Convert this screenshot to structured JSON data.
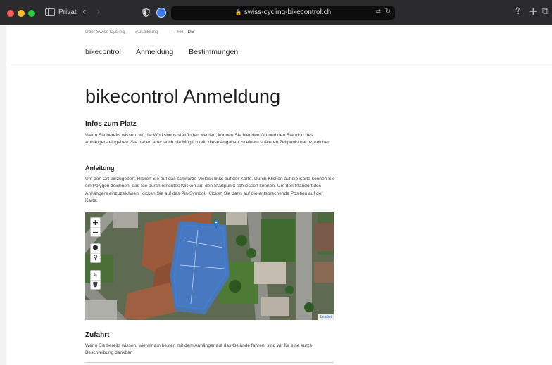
{
  "browser": {
    "tab_label": "Privat",
    "url": "swiss-cycling-bikecontrol.ch",
    "icons": [
      "sidebar-icon",
      "back-icon",
      "forward-icon",
      "shield-icon",
      "privacy-icon",
      "lock-icon",
      "translate-icon",
      "reload-icon",
      "share-icon",
      "new-tab-icon",
      "tabs-overview-icon"
    ]
  },
  "utility_nav": {
    "items": [
      "Über Swiss Cycling",
      "Ausbildung"
    ],
    "languages": [
      "IT",
      "FR",
      "DE"
    ],
    "active_language": "DE"
  },
  "main_nav": {
    "items": [
      "bikecontrol",
      "Anmeldung",
      "Bestimmungen"
    ]
  },
  "page": {
    "title": "bikecontrol Anmeldung",
    "section_place": {
      "heading": "Infos zum Platz",
      "text": "Wenn Sie bereits wissen, wo die Workshops stattfinden werden, können Sie hier den Ort und den Standort des Anhängers eingeben. Sie haben aber auch die Möglichkeit, diese Angaben zu einem späteren Zeitpunkt nachzureichen."
    },
    "section_instructions": {
      "heading": "Anleitung",
      "text": "Um den Ort einzugeben, klicken Sie auf das schwarze Vieleck links auf der Karte. Durch Klicken auf die Karte können Sie ein Polygon zeichnen, das Sie durch erneutes Klicken auf den Startpunkt schliessen können. Um den Standort des Anhängers einzuzeichnen, klicken Sie auf das Pin-Symbol. Klicken Sie dann auf die entsprechende Position auf der Karte."
    },
    "map": {
      "zoom_in": "+",
      "zoom_out": "−",
      "draw_polygon_icon": "⬢",
      "draw_marker_icon": "⚲",
      "edit_icon": "✎",
      "delete_icon": "🗑",
      "attribution": "Leaflet",
      "polygon_color": "#3f7fe0",
      "marker_color": "#2a81cb"
    },
    "section_access": {
      "heading": "Zufahrt",
      "text": "Wenn Sie bereits wissen, wie wir am besten mit dem Anhänger auf das Gelände fahren, sind wir für eine kurze Beschreibung dankbar."
    }
  }
}
